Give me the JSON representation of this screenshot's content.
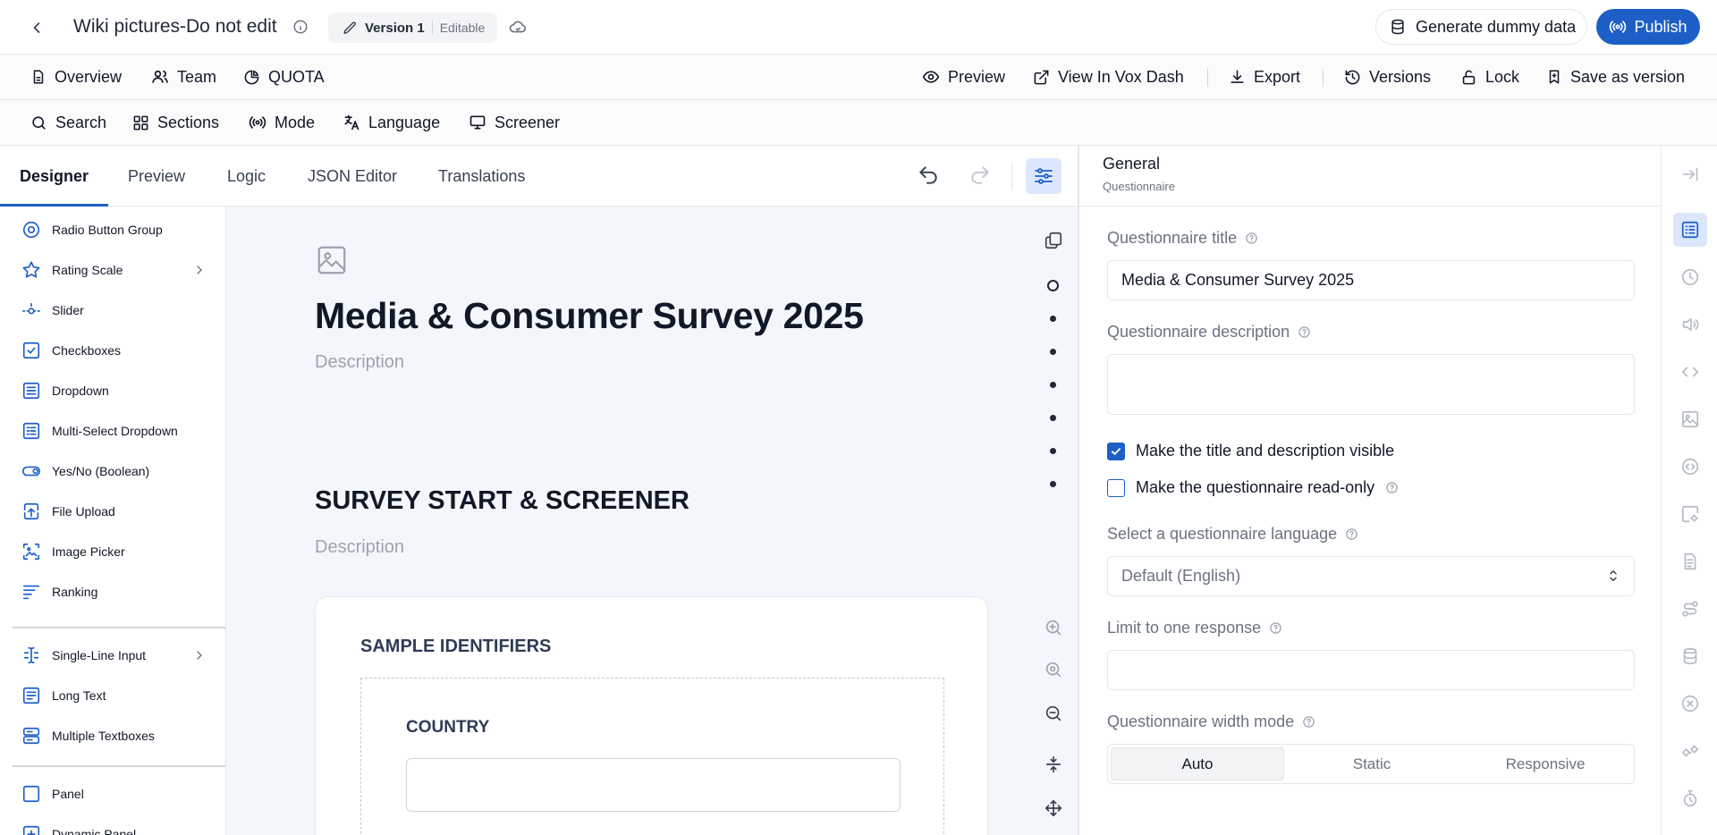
{
  "header": {
    "doc_title": "Wiki pictures-Do not edit",
    "version_name": "Version 1",
    "version_state": "Editable",
    "generate_label": "Generate dummy data",
    "publish_label": "Publish"
  },
  "nav": {
    "overview": "Overview",
    "team": "Team",
    "quota": "QUOTA",
    "preview": "Preview",
    "view_in_vox_dash": "View In Vox Dash",
    "export": "Export",
    "versions": "Versions",
    "lock": "Lock",
    "save_as_version": "Save as version"
  },
  "tools_bar": {
    "search": "Search",
    "sections": "Sections",
    "mode": "Mode",
    "language": "Language",
    "screener": "Screener"
  },
  "tabs": [
    "Designer",
    "Preview",
    "Logic",
    "JSON Editor",
    "Translations"
  ],
  "toolbox": {
    "items": [
      {
        "label": "Radio Button Group",
        "icon": "radio-icon"
      },
      {
        "label": "Rating Scale",
        "icon": "star-icon",
        "has_submenu": true
      },
      {
        "label": "Slider",
        "icon": "slider-icon"
      },
      {
        "label": "Checkboxes",
        "icon": "checkbox-icon"
      },
      {
        "label": "Dropdown",
        "icon": "dropdown-icon"
      },
      {
        "label": "Multi-Select Dropdown",
        "icon": "multi-dropdown-icon"
      },
      {
        "label": "Yes/No (Boolean)",
        "icon": "toggle-icon"
      },
      {
        "label": "File Upload",
        "icon": "upload-icon"
      },
      {
        "label": "Image Picker",
        "icon": "image-picker-icon"
      },
      {
        "label": "Ranking",
        "icon": "ranking-icon"
      },
      {
        "label": "Single-Line Input",
        "icon": "text-cursor-icon",
        "has_submenu": true
      },
      {
        "label": "Long Text",
        "icon": "long-text-icon"
      },
      {
        "label": "Multiple Textboxes",
        "icon": "multi-textbox-icon"
      },
      {
        "label": "Panel",
        "icon": "panel-icon"
      },
      {
        "label": "Dynamic Panel",
        "icon": "dynamic-panel-icon"
      }
    ]
  },
  "canvas": {
    "survey_title": "Media & Consumer Survey 2025",
    "survey_description": "Description",
    "section_title": "SURVEY START & SCREENER",
    "section_description": "Description",
    "panel_title": "SAMPLE IDENTIFIERS",
    "question_title": "COUNTRY"
  },
  "properties": {
    "header_title": "General",
    "header_subtitle": "Questionnaire",
    "title_label": "Questionnaire title",
    "title_value": "Media & Consumer Survey 2025",
    "description_label": "Questionnaire description",
    "visible_label": "Make the title and description visible",
    "visible_checked": true,
    "readonly_label": "Make the questionnaire read-only",
    "readonly_checked": false,
    "language_label": "Select a questionnaire language",
    "language_value": "Default (English)",
    "limit_label": "Limit to one response",
    "width_mode_label": "Questionnaire width mode",
    "width_modes": [
      "Auto",
      "Static",
      "Responsive"
    ],
    "width_mode_selected": "Auto"
  },
  "colors": {
    "accent": "#1d5fc7",
    "accent_light": "#dbe7fb",
    "canvas_bg": "#f3f6fa"
  }
}
